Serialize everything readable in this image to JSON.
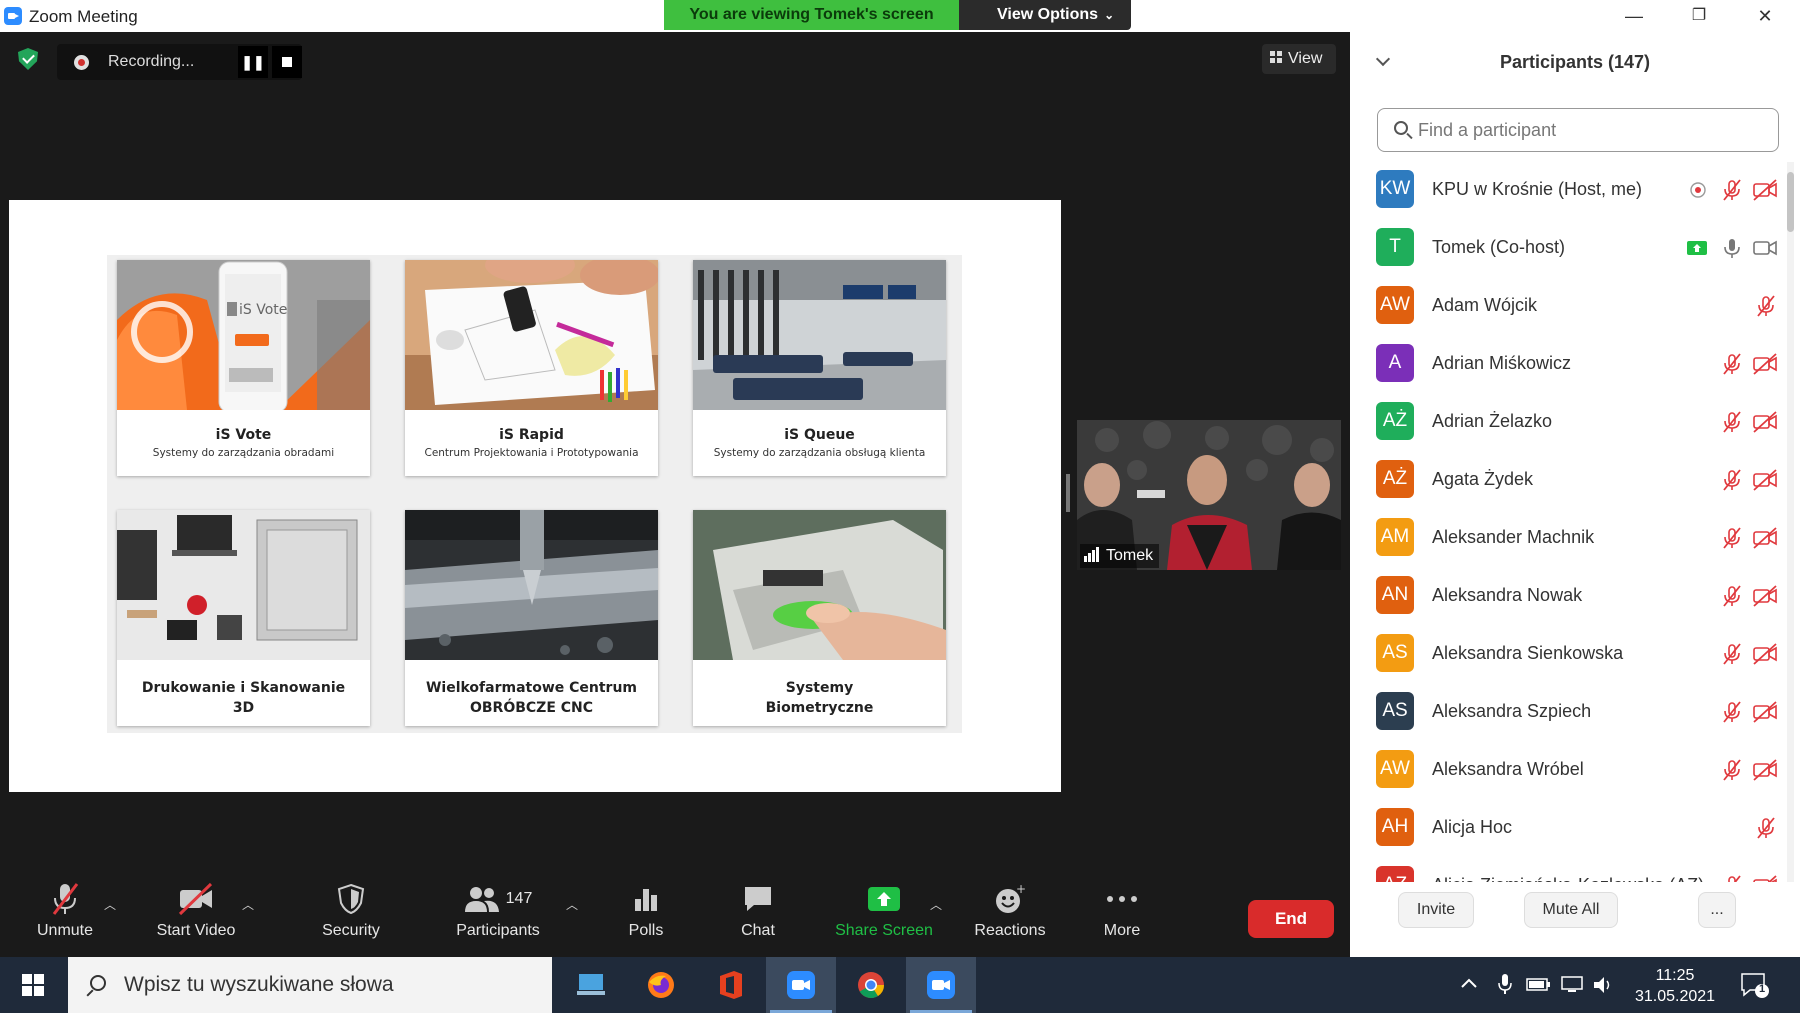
{
  "window": {
    "title": "Zoom Meeting",
    "minimize": "—",
    "restore": "❐",
    "close": "✕"
  },
  "share_banner": {
    "text": "You are viewing Tomek's screen",
    "view_options": "View Options"
  },
  "recording": {
    "label": "Recording..."
  },
  "view_button": "View",
  "slide": {
    "cards": [
      {
        "title": "iS Vote",
        "subtitle": "Systemy do zarządzania obradami",
        "vote_label": "iS Vote"
      },
      {
        "title": "iS Rapid",
        "subtitle": "Centrum Projektowania i Prototypowania"
      },
      {
        "title": "iS Queue",
        "subtitle": "Systemy do zarządzania obsługą klienta"
      },
      {
        "title_line1": "Drukowanie i Skanowanie",
        "title_line2": "3D"
      },
      {
        "title_line1": "Wielkofarmatowe Centrum",
        "title_line2": "OBRÓBCZE CNC"
      },
      {
        "title_line1": "Systemy",
        "title_line2": "Biometryczne"
      }
    ]
  },
  "video": {
    "name": "Tomek"
  },
  "toolbar": {
    "unmute": "Unmute",
    "start_video": "Start Video",
    "security": "Security",
    "participants": "Participants",
    "participants_count": "147",
    "polls": "Polls",
    "chat": "Chat",
    "share_screen": "Share Screen",
    "reactions": "Reactions",
    "more": "More",
    "end": "End"
  },
  "participants_panel": {
    "title": "Participants (147)",
    "search_placeholder": "Find a participant",
    "participants": [
      {
        "initials": "KW",
        "name": "KPU w Krośnie (Host, me)",
        "color": "#2e7bbf",
        "recording": true,
        "mic": "muted",
        "video": "off"
      },
      {
        "initials": "T",
        "name": "Tomek (Co-host)",
        "color": "#1fae5b",
        "sharing": true,
        "mic": "on",
        "video": "on"
      },
      {
        "initials": "AW",
        "name": "Adam Wójcik",
        "color": "#e0600f",
        "mic": "muted",
        "video": "none"
      },
      {
        "initials": "A",
        "name": "Adrian Miśkowicz",
        "color": "#7b2fb8",
        "mic": "muted",
        "video": "off"
      },
      {
        "initials": "AŻ",
        "name": "Adrian Żelazko",
        "color": "#1fae5b",
        "mic": "muted",
        "video": "off"
      },
      {
        "initials": "AŻ",
        "name": "Agata Żydek",
        "color": "#e0600f",
        "mic": "muted",
        "video": "off"
      },
      {
        "initials": "AM",
        "name": "Aleksander Machnik",
        "color": "#f39c12",
        "mic": "muted",
        "video": "off"
      },
      {
        "initials": "AN",
        "name": "Aleksandra Nowak",
        "color": "#e0600f",
        "mic": "muted",
        "video": "off"
      },
      {
        "initials": "AS",
        "name": "Aleksandra Sienkowska",
        "color": "#f39c12",
        "mic": "muted",
        "video": "off"
      },
      {
        "initials": "AS",
        "name": "Aleksandra Szpiech",
        "color": "#2c3e50",
        "mic": "muted",
        "video": "off"
      },
      {
        "initials": "AW",
        "name": "Aleksandra Wróbel",
        "color": "#f39c12",
        "mic": "muted",
        "video": "off"
      },
      {
        "initials": "AH",
        "name": "Alicja Hoc",
        "color": "#e0600f",
        "mic": "muted",
        "video": "none"
      },
      {
        "initials": "AZ",
        "name": "Alicja Ziemiańska-Kozłowska (AZ)",
        "color": "#d9342b",
        "mic": "muted",
        "video": "off"
      }
    ],
    "invite": "Invite",
    "mute_all": "Mute All",
    "more": "..."
  },
  "taskbar": {
    "search_placeholder": "Wpisz tu wyszukiwane słowa",
    "time": "11:25",
    "date": "31.05.2021",
    "notification_count": "1"
  },
  "colors": {
    "banner_green": "#3fbf3f",
    "end_red": "#d92b2b",
    "share_green": "#1fbf45",
    "muted_red": "#e0393e"
  }
}
